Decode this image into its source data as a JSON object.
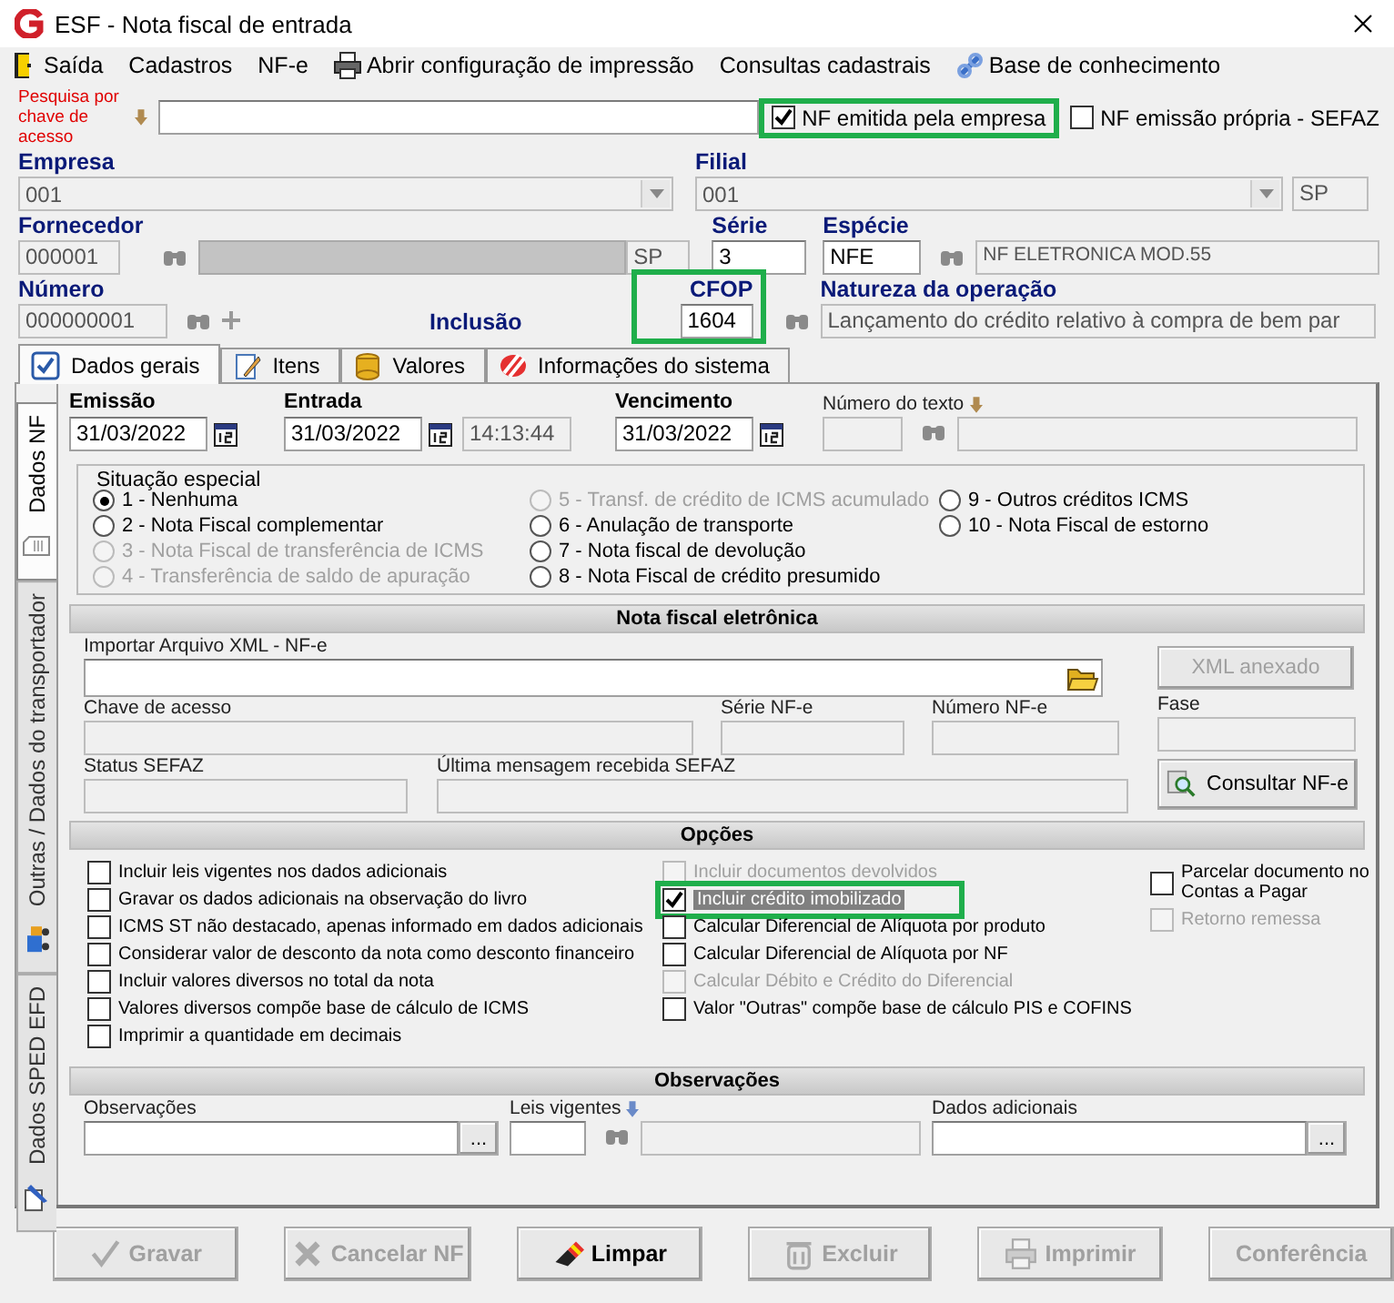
{
  "window": {
    "title": "ESF - Nota fiscal de entrada"
  },
  "menu": [
    {
      "label": "Saída"
    },
    {
      "label": "Cadastros"
    },
    {
      "label": "NF-e"
    },
    {
      "label": "Abrir configuração de impressão"
    },
    {
      "label": "Consultas cadastrais"
    },
    {
      "label": "Base de conhecimento"
    }
  ],
  "search": {
    "label": "Pesquisa por chave de acesso"
  },
  "flags": [
    {
      "label": "NF emitida pela empresa",
      "checked": true,
      "highlighted": true
    },
    {
      "label": "NF emissão própria - SEFAZ",
      "checked": false,
      "highlighted": false
    }
  ],
  "empresa": {
    "label": "Empresa",
    "value": "001"
  },
  "filial": {
    "label": "Filial",
    "value": "001",
    "uf": "SP"
  },
  "fornecedor": {
    "label": "Fornecedor",
    "code": "000001",
    "uf": "SP"
  },
  "serie": {
    "label": "Série",
    "value": "3"
  },
  "especie": {
    "label": "Espécie",
    "value": "NFE",
    "description": "NF ELETRONICA MOD.55"
  },
  "numero": {
    "label": "Número",
    "value": "000000001"
  },
  "mode": "Inclusão",
  "cfop": {
    "label": "CFOP",
    "value": "1604",
    "highlighted": true
  },
  "natureza": {
    "label": "Natureza da operação",
    "value": "Lançamento do crédito relativo à compra de bem par"
  },
  "tabs": [
    {
      "label": "Dados gerais",
      "selected": true
    },
    {
      "label": "Itens",
      "selected": false
    },
    {
      "label": "Valores",
      "selected": false
    },
    {
      "label": "Informações do sistema",
      "selected": false
    }
  ],
  "side_tabs": [
    {
      "label": "Dados NF",
      "selected": true
    },
    {
      "label": "Outras / Dados do transportador",
      "selected": false
    },
    {
      "label": "Dados SPED EFD",
      "selected": false
    }
  ],
  "dates": {
    "emissao": {
      "label": "Emissão",
      "value": "31/03/2022"
    },
    "entrada": {
      "label": "Entrada",
      "value": "31/03/2022",
      "time": "14:13:44"
    },
    "vencimento": {
      "label": "Vencimento",
      "value": "31/03/2022"
    },
    "numero_texto": {
      "label": "Número do texto"
    }
  },
  "situacao": {
    "title": "Situação especial",
    "options": [
      {
        "label": "1 - Nenhuma",
        "selected": true,
        "disabled": false
      },
      {
        "label": "2 - Nota Fiscal complementar",
        "selected": false,
        "disabled": false
      },
      {
        "label": "3 - Nota Fiscal de transferência de ICMS",
        "selected": false,
        "disabled": true
      },
      {
        "label": "4 - Transferência de saldo de apuração",
        "selected": false,
        "disabled": true
      },
      {
        "label": "5 - Transf. de crédito de ICMS acumulado",
        "selected": false,
        "disabled": true
      },
      {
        "label": "6 - Anulação de transporte",
        "selected": false,
        "disabled": false
      },
      {
        "label": "7 - Nota fiscal de devolução",
        "selected": false,
        "disabled": false
      },
      {
        "label": "8 - Nota Fiscal de crédito presumido",
        "selected": false,
        "disabled": false
      },
      {
        "label": "9 - Outros créditos ICMS",
        "selected": false,
        "disabled": false
      },
      {
        "label": "10 - Nota Fiscal de estorno",
        "selected": false,
        "disabled": false
      }
    ]
  },
  "nfe": {
    "title": "Nota fiscal eletrônica",
    "import_label": "Importar Arquivo XML - NF-e",
    "xml_button": {
      "label": "XML anexado",
      "disabled": true
    },
    "fields": [
      {
        "label": "Chave de acesso"
      },
      {
        "label": "Série NF-e"
      },
      {
        "label": "Número NF-e"
      },
      {
        "label": "Fase"
      },
      {
        "label": "Status SEFAZ"
      },
      {
        "label": "Última mensagem recebida SEFAZ"
      }
    ],
    "consult_button": "Consultar NF-e"
  },
  "opcoes": {
    "title": "Opções",
    "columns": [
      [
        {
          "label": "Incluir leis vigentes nos dados adicionais",
          "checked": false,
          "disabled": false,
          "highlighted": false
        },
        {
          "label": "Gravar os dados adicionais na observação do livro",
          "checked": false,
          "disabled": false,
          "highlighted": false
        },
        {
          "label": "ICMS ST  não destacado, apenas informado em dados adicionais",
          "checked": false,
          "disabled": false,
          "highlighted": false
        },
        {
          "label": "Considerar valor de desconto da nota como desconto financeiro",
          "checked": false,
          "disabled": false,
          "highlighted": false
        },
        {
          "label": "Incluir valores diversos no total da nota",
          "checked": false,
          "disabled": false,
          "highlighted": false
        },
        {
          "label": "Valores diversos compõe base de cálculo de ICMS",
          "checked": false,
          "disabled": false,
          "highlighted": false
        },
        {
          "label": "Imprimir a quantidade em decimais",
          "checked": false,
          "disabled": false,
          "highlighted": false
        }
      ],
      [
        {
          "label": "Incluir documentos devolvidos",
          "checked": false,
          "disabled": true,
          "highlighted": false
        },
        {
          "label": "Incluir crédito imobilizado",
          "checked": true,
          "disabled": false,
          "highlighted": true
        },
        {
          "label": "Calcular Diferencial de Alíquota por produto",
          "checked": false,
          "disabled": false,
          "highlighted": false
        },
        {
          "label": "Calcular Diferencial de Alíquota por NF",
          "checked": false,
          "disabled": false,
          "highlighted": false
        },
        {
          "label": "Calcular Débito e Crédito do Diferencial",
          "checked": false,
          "disabled": true,
          "highlighted": false
        },
        {
          "label": "Valor \"Outras\" compõe base de cálculo PIS e COFINS",
          "checked": false,
          "disabled": false,
          "highlighted": false
        }
      ],
      [
        {
          "label": "Parcelar documento no Contas a Pagar",
          "checked": false,
          "disabled": false,
          "highlighted": false
        },
        {
          "label": "Retorno remessa",
          "checked": false,
          "disabled": true,
          "highlighted": false
        }
      ]
    ]
  },
  "observacoes": {
    "title": "Observações",
    "fields": [
      {
        "label": "Observações",
        "browse": "..."
      },
      {
        "label": "Leis vigentes"
      },
      {
        "label": "Dados adicionais",
        "browse": "..."
      }
    ]
  },
  "buttons": [
    {
      "label": "Gravar",
      "disabled": true
    },
    {
      "label": "Cancelar NF",
      "disabled": true
    },
    {
      "label": "Limpar",
      "disabled": false
    },
    {
      "label": "Excluir",
      "disabled": true
    },
    {
      "label": "Imprimir",
      "disabled": true
    },
    {
      "label": "Conferência",
      "disabled": true
    }
  ]
}
